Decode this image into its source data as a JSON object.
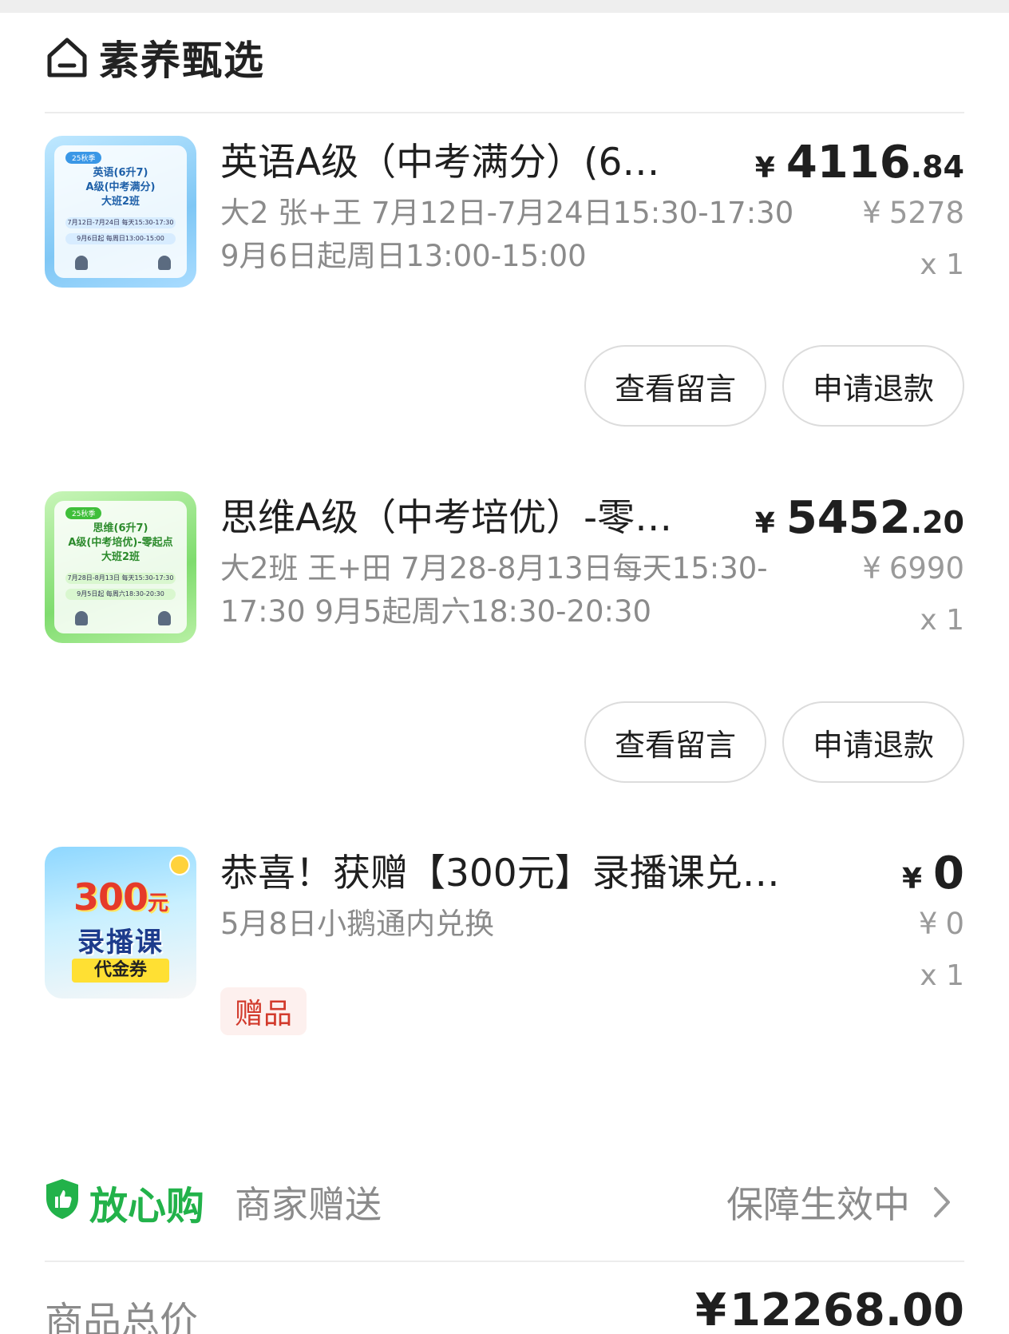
{
  "shop": {
    "name": "素养甄选",
    "icon": "home-icon"
  },
  "products": [
    {
      "title": "英语A级（中考满分）(6…",
      "price_currency": "¥",
      "price_int": "4116",
      "price_dec": ".84",
      "desc": "大2 张+王 7月12日-7月24日15:30-17:30 9月6日起周日13:00-15:00",
      "orig_currency": "¥",
      "orig_price": "5278",
      "qty": "x 1",
      "thumb": {
        "tag": "25秋季",
        "title_lines": [
          "英语(6升7)",
          "A级(中考满分)",
          "大班2班"
        ],
        "schedule_lines": [
          "7月12日-7月24日 每天15:30-17:30",
          "9月6日起 每周日13:00-15:00"
        ]
      },
      "buttons": {
        "view": "查看留言",
        "refund": "申请退款"
      }
    },
    {
      "title": "思维A级（中考培优）-零…",
      "price_currency": "¥",
      "price_int": "5452",
      "price_dec": ".20",
      "desc": "大2班 王+田 7月28-8月13日每天15:30-17:30 9月5起周六18:30-20:30",
      "orig_currency": "¥",
      "orig_price": "6990",
      "qty": "x 1",
      "thumb": {
        "tag": "25秋季",
        "title_lines": [
          "思维(6升7)",
          "A级(中考培优)-零起点",
          "大班2班"
        ],
        "schedule_lines": [
          "7月28日-8月13日 每天15:30-17:30",
          "9月5日起 每周六18:30-20:30"
        ]
      },
      "buttons": {
        "view": "查看留言",
        "refund": "申请退款"
      }
    },
    {
      "title": "恭喜！获赠【300元】录播课兑…",
      "price_currency": "¥",
      "price_int": "0",
      "desc": "5月8日小鹅通内兑换",
      "orig_currency": "¥",
      "orig_price": "0",
      "qty": "x 1",
      "badge": "赠品",
      "thumb": {
        "amount": "300",
        "unit": "元",
        "line1": "录播课",
        "line2": "代金券"
      }
    }
  ],
  "assurance": {
    "brand": "放心购",
    "sub": "商家赠送",
    "status": "保障生效中",
    "colors": {
      "brand": "#22b24a"
    }
  },
  "total": {
    "label": "商品总价",
    "currency": "¥",
    "value": "12268.00"
  }
}
